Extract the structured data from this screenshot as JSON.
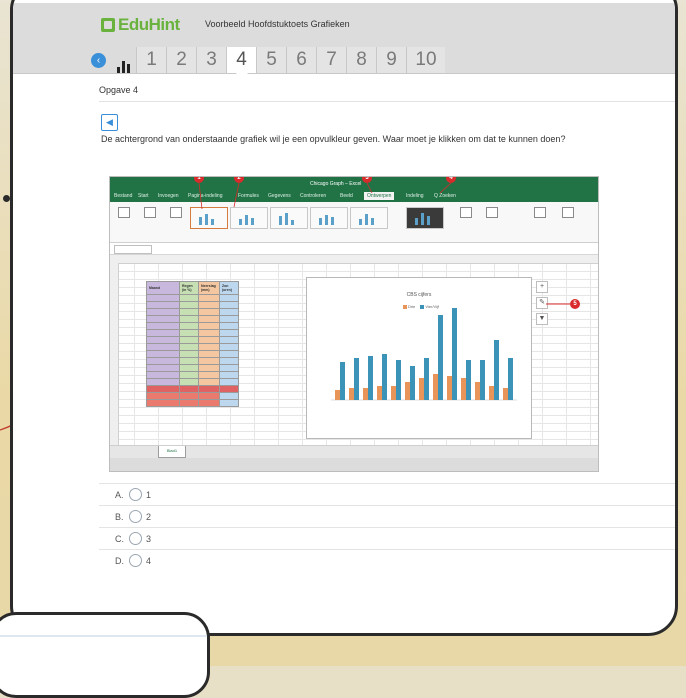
{
  "app": {
    "brand": "EduHint",
    "title": "Voorbeeld Hoofdstuktoets Grafieken"
  },
  "nav": {
    "back_icon": "chevron-left-icon",
    "stats_icon": "bar-chart-icon",
    "tabs": [
      "1",
      "2",
      "3",
      "4",
      "5",
      "6",
      "7",
      "8",
      "9",
      "10"
    ],
    "active_tab": "4"
  },
  "question": {
    "label": "Opgave 4",
    "text": "De achtergrond van onderstaande grafiek wil je een opvulkleur geven. Waar moet je klikken om dat te kunnen doen?"
  },
  "screenshot": {
    "tabs": [
      "Bestand",
      "Start",
      "Invoegen",
      "Pagina-indeling",
      "Formules",
      "Gegevens",
      "Controleren",
      "Beeld",
      "Ontwerpen",
      "Indeling",
      "Q Zoeken"
    ],
    "active_tab": "Ontwerpen",
    "title_center": "Chicago Graph – Excel",
    "sheet_tab": "Blad1",
    "chart_title": "CBS cijfers",
    "legend": [
      "Drie",
      "Vier/Vijf"
    ],
    "markers": [
      "1",
      "2",
      "3",
      "4",
      "5"
    ],
    "table_headers": [
      "Maand",
      "Regen (in %)",
      "Neerslag (mm)",
      "Zon (uren)"
    ]
  },
  "answers": [
    {
      "letter": "A.",
      "value": "1"
    },
    {
      "letter": "B.",
      "value": "2"
    },
    {
      "letter": "C.",
      "value": "3"
    },
    {
      "letter": "D.",
      "value": "4"
    }
  ],
  "colors": {
    "accent": "#3a8fd9",
    "brand_green": "#6ab23e",
    "excel_green": "#217346",
    "marker_red": "#d92b2b"
  }
}
